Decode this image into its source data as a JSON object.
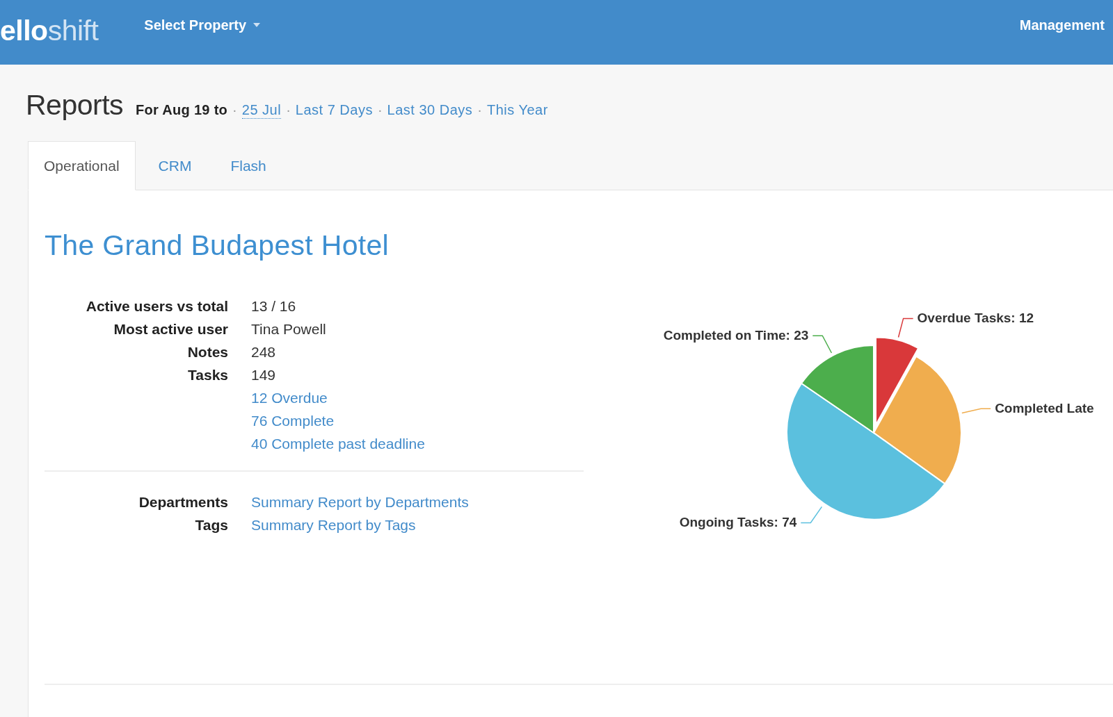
{
  "header": {
    "logo": "**ello**shift",
    "property_menu": "Select Property",
    "right_menu": "Management"
  },
  "title": "Reports",
  "date_range": [
    {
      "kind": "text",
      "text": "For Aug 19 to"
    },
    {
      "kind": "separator",
      "text": "·"
    },
    {
      "kind": "date",
      "text": "25 Jul"
    },
    {
      "kind": "separator",
      "text": "·"
    },
    {
      "kind": "link",
      "text": "Last 7 Days"
    },
    {
      "kind": "separator",
      "text": "·"
    },
    {
      "kind": "link",
      "text": "Last 30 Days"
    },
    {
      "kind": "separator",
      "text": "·"
    },
    {
      "kind": "link",
      "text": "This Year"
    }
  ],
  "tabs": [
    {
      "label": "Operational",
      "selected": true
    },
    {
      "label": "CRM",
      "selected": false
    },
    {
      "label": "Flash",
      "selected": false
    }
  ],
  "report": {
    "title": "The Grand Budapest Hotel",
    "stats": [
      {
        "label": "Active users vs total",
        "value": "13 / 16"
      },
      {
        "label": "Most active user",
        "value": "Tina Powell"
      },
      {
        "label": "Notes",
        "value": "248"
      },
      {
        "label": "Tasks",
        "value": "149",
        "links": [
          "12 Overdue",
          "76 Complete",
          "40 Complete past deadline"
        ]
      }
    ],
    "summaries": [
      {
        "label": "Departments",
        "link": "Summary Report by Departments"
      },
      {
        "label": "Tags",
        "link": "Summary Report by Tags"
      }
    ],
    "chart_data": {
      "type": "pie",
      "categories": [
        "Overdue Tasks: 12",
        "Completed Late",
        "Ongoing Tasks: 74",
        "Completed on Time: 23"
      ],
      "values": [
        12,
        40,
        74,
        23
      ],
      "colors": [
        "#d9383a",
        "#f0ad4e",
        "#5bc0de",
        "#4cae4c"
      ]
    }
  }
}
